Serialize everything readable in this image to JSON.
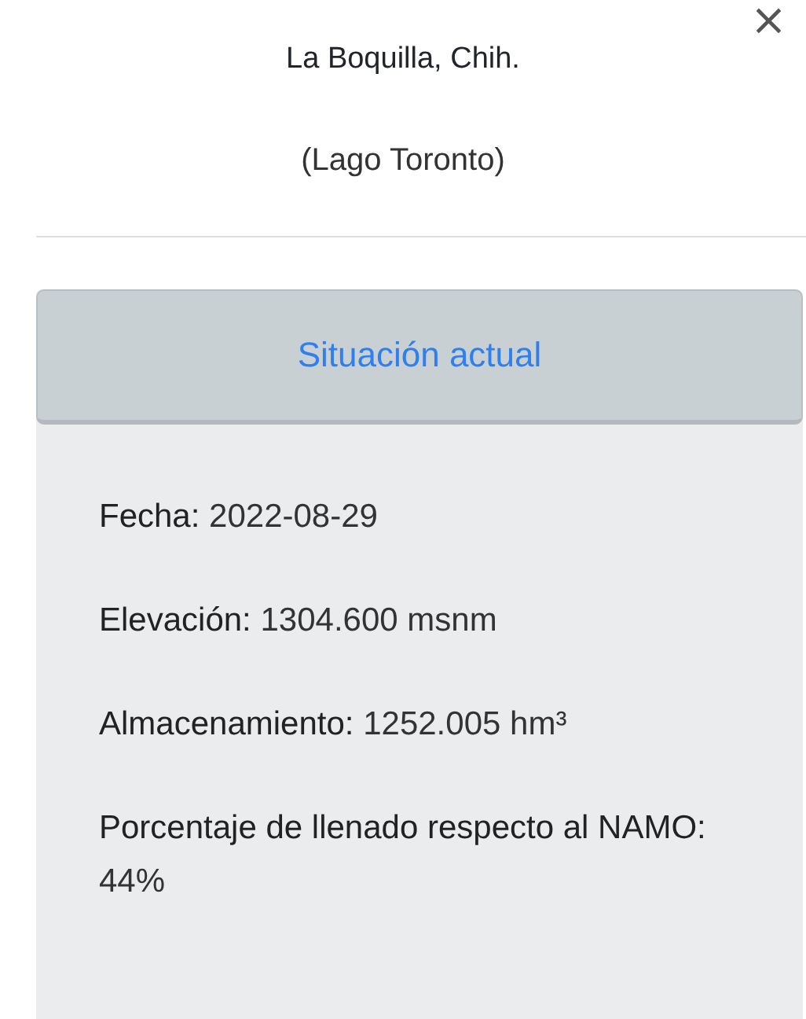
{
  "popup": {
    "close": "×",
    "title": "La Boquilla, Chih.",
    "subtitle": "(Lago Toronto)"
  },
  "panel": {
    "header": "Situación actual",
    "fields": [
      {
        "label": "Fecha:",
        "value": "2022-08-29"
      },
      {
        "label": "Elevación:",
        "value": "1304.600 msnm"
      },
      {
        "label": "Almacenamiento:",
        "value": "1252.005 hm³"
      },
      {
        "label": "Porcentaje de llenado respecto al NAMO:",
        "value": "44%"
      }
    ]
  }
}
